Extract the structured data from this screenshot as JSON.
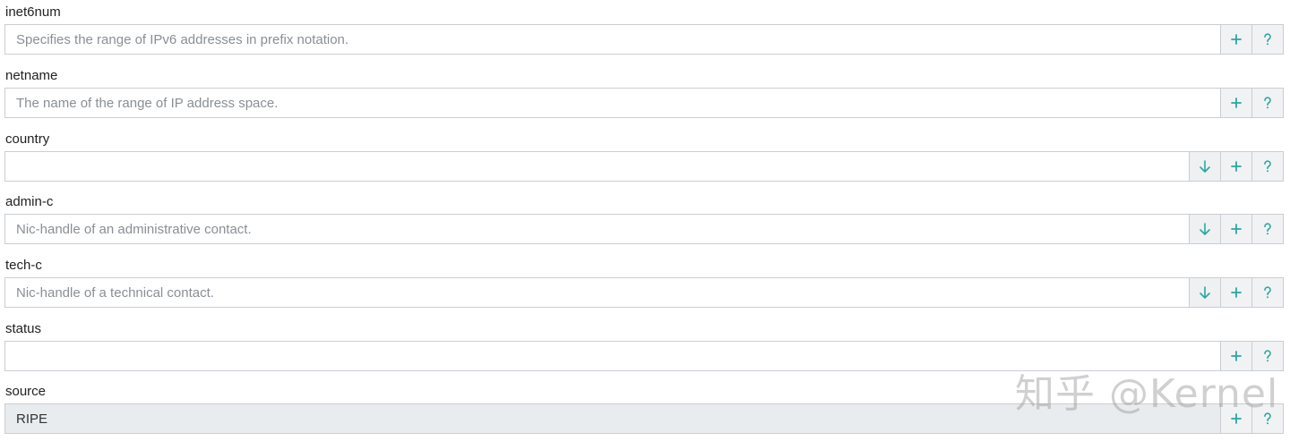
{
  "fields": [
    {
      "label": "inet6num",
      "value": "",
      "placeholder": "Specifies the range of IPv6 addresses in prefix notation.",
      "has_dropdown": false,
      "readonly": false
    },
    {
      "label": "netname",
      "value": "",
      "placeholder": "The name of the range of IP address space.",
      "has_dropdown": false,
      "readonly": false
    },
    {
      "label": "country",
      "value": "",
      "placeholder": "",
      "has_dropdown": true,
      "readonly": false
    },
    {
      "label": "admin-c",
      "value": "",
      "placeholder": "Nic-handle of an administrative contact.",
      "has_dropdown": true,
      "readonly": false
    },
    {
      "label": "tech-c",
      "value": "",
      "placeholder": "Nic-handle of a technical contact.",
      "has_dropdown": true,
      "readonly": false
    },
    {
      "label": "status",
      "value": "",
      "placeholder": "",
      "has_dropdown": false,
      "readonly": false
    },
    {
      "label": "source",
      "value": "RIPE",
      "placeholder": "",
      "has_dropdown": false,
      "readonly": true
    }
  ],
  "icons": {
    "dropdown": "arrow-down-icon",
    "add": "plus-icon",
    "help": "question-icon"
  },
  "colors": {
    "accent": "#2aa7a0",
    "border": "#c9ced3",
    "readonly_bg": "#e9ecef"
  },
  "watermark": "知乎 @Kernel"
}
